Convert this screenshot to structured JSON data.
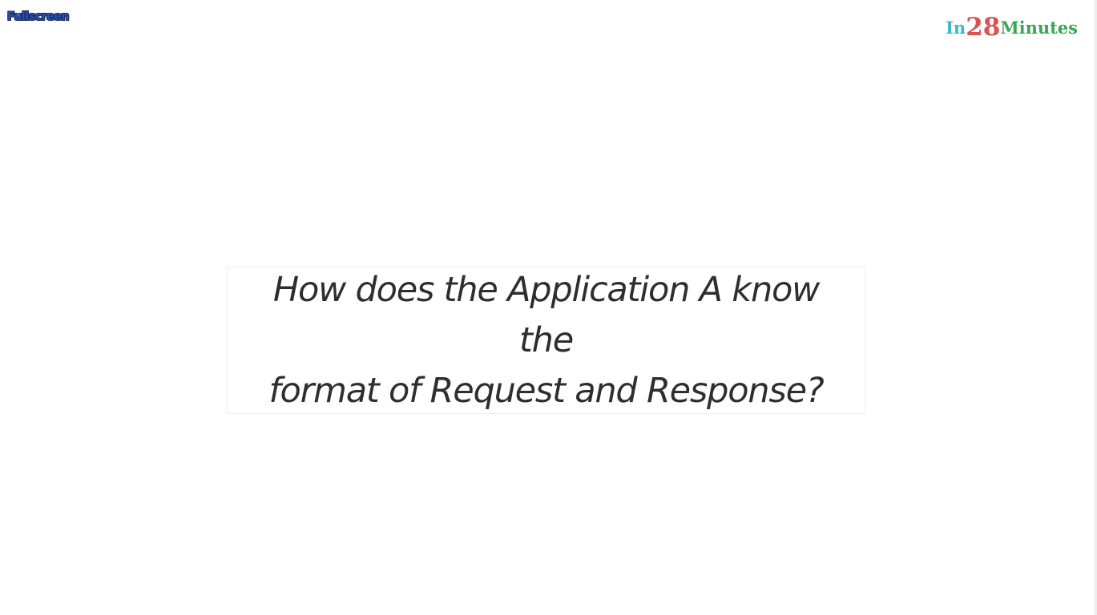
{
  "toolbar": {
    "fullscreen_label": "Fullscreen"
  },
  "brand": {
    "part_in": "In",
    "part_number": "28",
    "part_minutes": "Minutes",
    "colors": {
      "in": "#3fb7c7",
      "number": "#d9534f",
      "minutes": "#3aa655"
    }
  },
  "slide": {
    "question_line_1": "How does the Application A know the",
    "question_line_2": "format of Request and Response?"
  }
}
